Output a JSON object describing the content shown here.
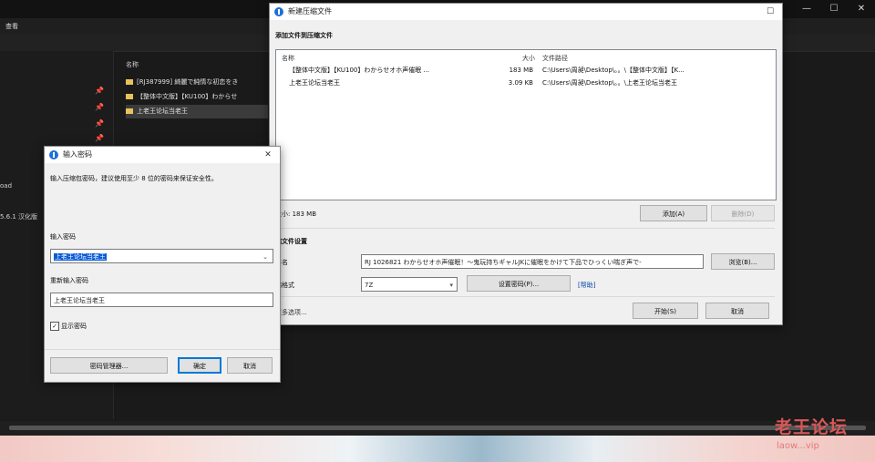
{
  "explorer": {
    "ribbon_tab": "查看",
    "list_header": "名称",
    "nav_items": [
      {
        "label": "",
        "pinned": true
      },
      {
        "label": "",
        "pinned": true
      },
      {
        "label": "",
        "pinned": true
      },
      {
        "label": "",
        "pinned": true
      },
      {
        "label": "oad",
        "pinned": false
      },
      {
        "label": "5.6.1 汉化版",
        "pinned": false
      }
    ],
    "files": [
      {
        "name": "[RJ387999] 綺麗で純情な初恋をき"
      },
      {
        "name": "【整体中文版】【KU100】わからせ"
      },
      {
        "name": "上老王论坛当老王"
      }
    ]
  },
  "archive_dialog": {
    "title": "新建压缩文件",
    "section_add": "添加文件到压缩文件",
    "columns": {
      "name": "名称",
      "size": "大小",
      "path": "文件路径"
    },
    "rows": [
      {
        "name": "【整体中文版】【KU100】わからせオホ声催眠 ...",
        "size": "183 MB",
        "path": "C:\\Users\\周昶\\Desktop\\。。\\【整体中文版】【K..."
      },
      {
        "name": "上老王论坛当老王",
        "size": "3.09 KB",
        "path": "C:\\Users\\周昶\\Desktop\\。。\\上老王论坛当老王"
      }
    ],
    "total_size": "大小: 183 MB",
    "add_button": "添加(A)",
    "delete_button": "删除(D)",
    "section_settings": "缩文件设置",
    "filename_label": "件名",
    "filename_value": "RJ 1026821 わからせオホ声催眠！～鬼玩持ちギャルJKに催眠をかけて下品でひっくい喘ぎ声で-",
    "browse_button": "浏览(B)...",
    "format_label": "缩格式",
    "format_value": "7Z",
    "set_password_button": "设置密码(P)...",
    "help_link": "[帮助]",
    "more_options": "更多选项...",
    "start_button": "开始(S)",
    "cancel_button": "取消"
  },
  "password_dialog": {
    "title": "输入密码",
    "hint": "输入压缩包密码，建议使用至少 8 位的密码来保证安全性。",
    "password_label": "输入密码",
    "password_value": "上老王论坛当老王",
    "confirm_label": "重新输入密码",
    "confirm_value": "上老王论坛当老王",
    "show_password_label": "显示密码",
    "show_password_checked": true,
    "manager_button": "密码管理器...",
    "ok_button": "确定",
    "cancel_button": "取消"
  },
  "watermark": {
    "text": "老王论坛",
    "url": "laow...vip"
  }
}
